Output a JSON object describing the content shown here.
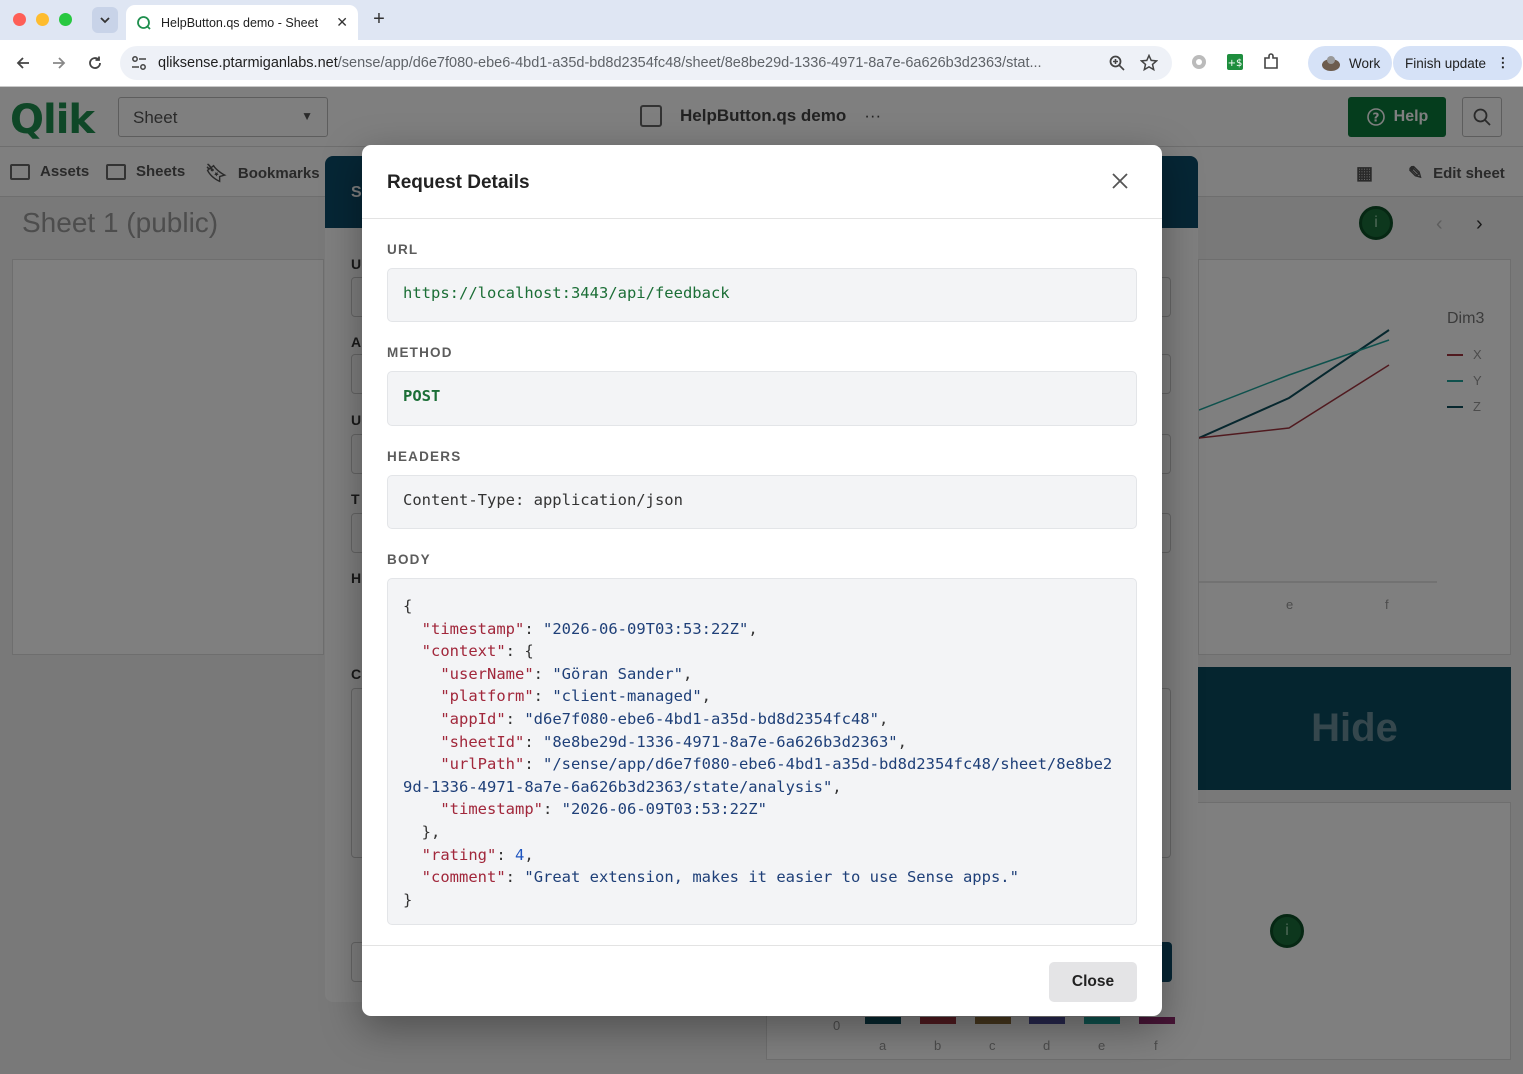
{
  "browser": {
    "tab_title": "HelpButton.qs demo - Sheet",
    "url_host": "qliksense.ptarmiganlabs.net",
    "url_path": "/sense/app/d6e7f080-ebe6-4bd1-a35d-bd8d2354fc48/sheet/8e8be29d-1336-4971-8a7e-6a626b3d2363/stat...",
    "profile_label": "Work",
    "update_label": "Finish update"
  },
  "app": {
    "logo_text": "Qlik",
    "sheet_select_label": "Sheet",
    "title": "HelpButton.qs demo",
    "title_more": "···",
    "help_label": "Help",
    "nav": {
      "assets": "Assets",
      "sheets": "Sheets",
      "bookmarks": "Bookmarks",
      "edit_sheet": "Edit sheet"
    },
    "sheet_heading": "Sheet 1 (public)",
    "legend": {
      "title": "Dim3",
      "items": [
        {
          "label": "X",
          "color": "#a0343f"
        },
        {
          "label": "Y",
          "color": "#1fa39a"
        },
        {
          "label": "Z",
          "color": "#0e4f5c"
        }
      ]
    },
    "hide_tile_label": "Hide",
    "line_axis_labels": [
      "e",
      "f"
    ],
    "bar_axis_labels": [
      "a",
      "b",
      "c",
      "d",
      "e",
      "f"
    ],
    "bar_axis_zero": "0",
    "back_modal_letters": [
      "S",
      "U",
      "A",
      "U",
      "T",
      "H",
      "C"
    ]
  },
  "dialog": {
    "title": "Request Details",
    "url_label": "URL",
    "url_value": "https://localhost:3443/api/feedback",
    "method_label": "METHOD",
    "method_value": "POST",
    "headers_label": "HEADERS",
    "headers_value": "Content-Type: application/json",
    "body_label": "BODY",
    "body": {
      "timestamp": "2026-06-09T03:53:22Z",
      "context": {
        "userName": "Göran Sander",
        "platform": "client-managed",
        "appId": "d6e7f080-ebe6-4bd1-a35d-bd8d2354fc48",
        "sheetId": "8e8be29d-1336-4971-8a7e-6a626b3d2363",
        "urlPath": "/sense/app/d6e7f080-ebe6-4bd1-a35d-bd8d2354fc48/sheet/8e8be29d-1336-4971-8a7e-6a626b3d2363/state/analysis",
        "timestamp": "2026-06-09T03:53:22Z"
      },
      "rating": 4,
      "comment": "Great extension, makes it easier to use Sense apps."
    },
    "close_label": "Close"
  }
}
